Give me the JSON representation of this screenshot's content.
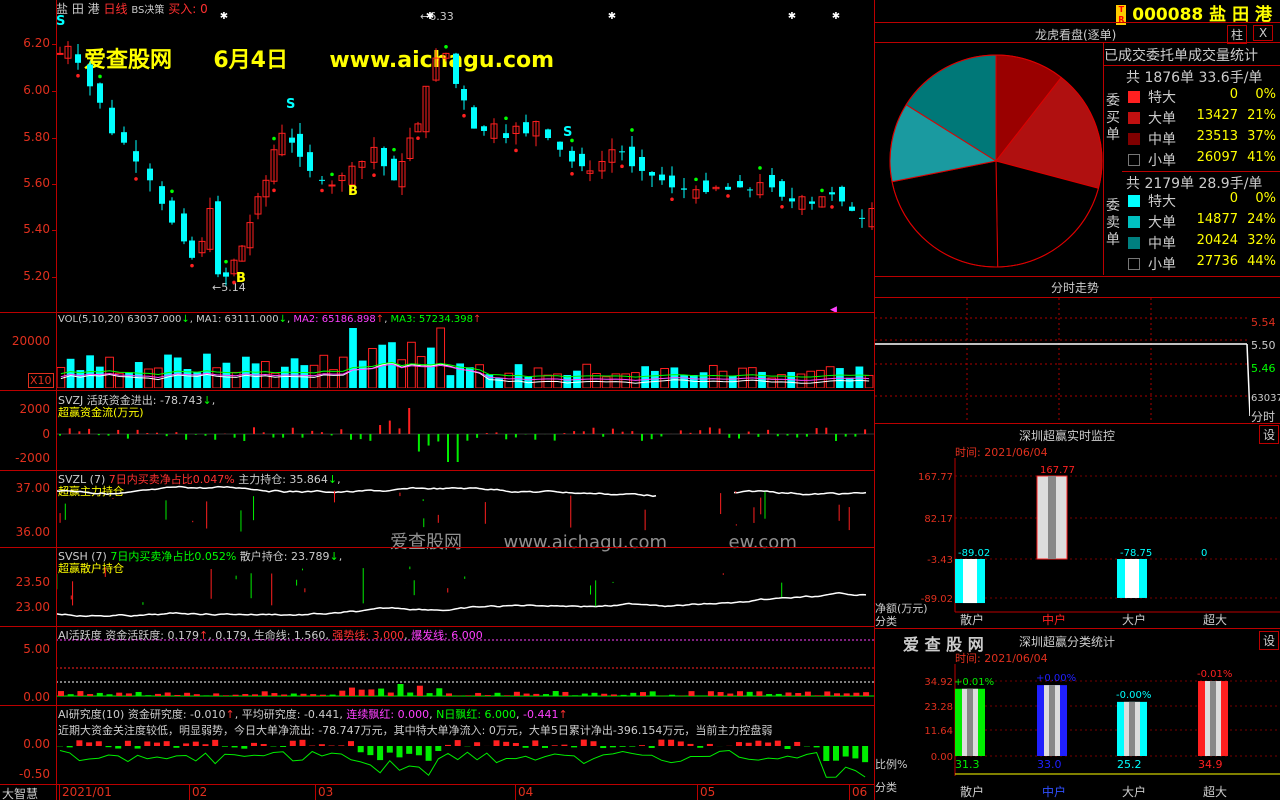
{
  "header": {
    "stock_name": "盐 田 港",
    "period": "日线",
    "strategy": "BS决策",
    "buy_label": "买入:",
    "buy_value": "0",
    "stock_code": "000088",
    "code_name": "盐 田 港",
    "btn_bar": "柱",
    "btn_close": "X"
  },
  "watermark": {
    "site": "爱查股网",
    "date": "6月4日",
    "url": "www.aichagu.com",
    "mid": "爱查股网",
    "mid_url": "www.aichagu.com",
    "mid_tail": "ew.com"
  },
  "price_chart": {
    "yticks": [
      "6.20",
      "6.00",
      "5.80",
      "5.60",
      "5.40",
      "5.20"
    ],
    "high_label": "6.33",
    "low_label": "5.14",
    "signals": [
      "S",
      "S",
      "S",
      "B",
      "B"
    ]
  },
  "vol": {
    "title": "VOL(5,10,20)",
    "v": "63037.000",
    "ma1": "MA1: 63111.000",
    "ma2": "MA2: 65186.898",
    "ma3": "MA3: 57234.398",
    "ytick": "20000",
    "unit": "X10"
  },
  "svzj": {
    "title": "SVZJ",
    "label": "活跃资金进出: -78.743",
    "sub": "超赢资金流(万元)",
    "yticks": [
      "2000",
      "0",
      "-2000"
    ]
  },
  "svzl": {
    "title": "SVZL (7)",
    "ratio": "7日内买卖净占比0.047%",
    "main": "主力持仓: 35.864",
    "sub": "超赢主力持仓",
    "yticks": [
      "37.00",
      "36.00"
    ]
  },
  "svsh": {
    "title": "SVSH (7)",
    "ratio": "7日内买卖净占比0.052%",
    "retail": "散户持仓: 23.789",
    "sub": "超赢散户持仓",
    "yticks": [
      "23.50",
      "23.00"
    ]
  },
  "ai_active": {
    "title": "AI活跃度",
    "a": "资金活跃度: 0.179",
    "b": "0.179",
    "c": "生命线: 1.560",
    "d": "强势线: 3.000",
    "e": "爆发线: 6.000",
    "yticks": [
      "5.00",
      "0.00"
    ]
  },
  "ai_research": {
    "title": "AI研究度(10)",
    "a": "资金研究度: -0.010",
    "b": "平均研究度: -0.441",
    "c": "连续飘红: 0.000",
    "d": "N日飘红: 6.000",
    "e": "-0.441",
    "desc": "近期大资金关注度较低，明显弱势，今日大单净流出: -78.747万元，其中特大单净流入: 0万元，大单5日累计净出-396.154万元，当前主力控盘弱",
    "yticks": [
      "0.00",
      "-0.50"
    ]
  },
  "xaxis": {
    "brand": "大智慧",
    "labels": [
      "2021/01",
      "02",
      "03",
      "04",
      "05",
      "06"
    ]
  },
  "dragon": {
    "title": "龙虎看盘(逐单)",
    "subtitle": "已成交委托单成交量统计",
    "buy_side": "委买单",
    "sell_side": "委卖单",
    "buy_total": "共 1876单 33.6手/单",
    "sell_total": "共 2179单 28.9手/单",
    "buy_rows": [
      {
        "name": "特大",
        "value": "0",
        "pct": "0%",
        "color": "#ff2020"
      },
      {
        "name": "大单",
        "value": "13427",
        "pct": "21%",
        "color": "#c01010"
      },
      {
        "name": "中单",
        "value": "23513",
        "pct": "37%",
        "color": "#800000"
      },
      {
        "name": "小单",
        "value": "26097",
        "pct": "41%",
        "color": "#000000"
      }
    ],
    "sell_rows": [
      {
        "name": "特大",
        "value": "0",
        "pct": "0%",
        "color": "#00ffff"
      },
      {
        "name": "大单",
        "value": "14877",
        "pct": "24%",
        "color": "#00c0c0"
      },
      {
        "name": "中单",
        "value": "20424",
        "pct": "32%",
        "color": "#008080"
      },
      {
        "name": "小单",
        "value": "27736",
        "pct": "44%",
        "color": "#000000"
      }
    ]
  },
  "intraday": {
    "title": "分时走势",
    "yticks": [
      "5.54",
      "5.50",
      "5.46"
    ],
    "vol": "63037",
    "vol_label": "分时"
  },
  "monitor": {
    "title": "深圳超赢实时监控",
    "btn": "设",
    "time": "时间: 2021/06/04",
    "yticks": [
      "167.77",
      "82.17",
      "-3.43",
      "-89.02"
    ],
    "ylabel": "净额(万元)",
    "xlabel": "分类",
    "categories": [
      "散户",
      "中户",
      "大户",
      "超大"
    ],
    "bar_labels": [
      "-89.02",
      "167.77",
      "-78.75",
      "0"
    ]
  },
  "classify": {
    "brand": "爱 查 股 网",
    "title": "深圳超赢分类统计",
    "btn": "设",
    "time": "时间: 2021/06/04",
    "yticks": [
      "34.92",
      "23.28",
      "11.64",
      "0.00"
    ],
    "ylabel": "比例%",
    "xlabel": "分类",
    "categories": [
      "散户",
      "中户",
      "大户",
      "超大"
    ],
    "top_labels": [
      "+0.01%",
      "+0.00%",
      "-0.00%",
      "-0.01%"
    ],
    "bottom_labels": [
      "31.3",
      "33.0",
      "25.2",
      "34.9"
    ]
  },
  "chart_data": [
    {
      "type": "pie",
      "title": "已成交委托单成交量统计",
      "categories": [
        "买特大",
        "买大单",
        "买中单",
        "买小单",
        "卖特大",
        "卖大单",
        "卖中单",
        "卖小单"
      ],
      "values": [
        0,
        21,
        37,
        41,
        0,
        24,
        32,
        44
      ]
    },
    {
      "type": "bar",
      "title": "深圳超赢实时监控",
      "categories": [
        "散户",
        "中户",
        "大户",
        "超大"
      ],
      "values": [
        -89.02,
        167.77,
        -78.75,
        0
      ],
      "ylabel": "净额(万元)",
      "ylim": [
        -89.02,
        167.77
      ]
    },
    {
      "type": "bar",
      "title": "深圳超赢分类统计",
      "categories": [
        "散户",
        "中户",
        "大户",
        "超大"
      ],
      "values": [
        31.3,
        33.0,
        25.2,
        34.9
      ],
      "ylabel": "比例%",
      "ylim": [
        0,
        34.92
      ],
      "colors": [
        "#00ee00",
        "#2020ff",
        "#00ffff",
        "#ff2020"
      ]
    }
  ]
}
